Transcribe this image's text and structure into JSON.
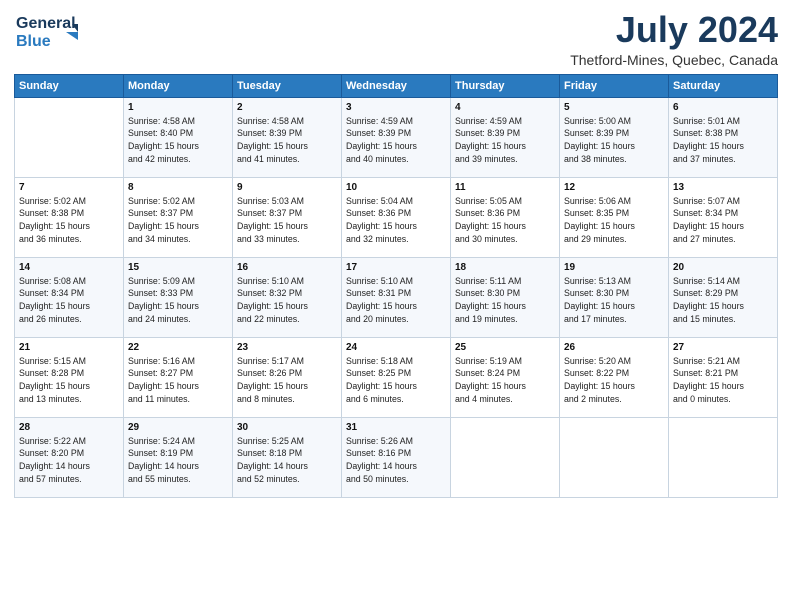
{
  "header": {
    "logo_line1": "General",
    "logo_line2": "Blue",
    "month_year": "July 2024",
    "location": "Thetford-Mines, Quebec, Canada"
  },
  "weekdays": [
    "Sunday",
    "Monday",
    "Tuesday",
    "Wednesday",
    "Thursday",
    "Friday",
    "Saturday"
  ],
  "weeks": [
    [
      {
        "day": "",
        "info": ""
      },
      {
        "day": "1",
        "info": "Sunrise: 4:58 AM\nSunset: 8:40 PM\nDaylight: 15 hours\nand 42 minutes."
      },
      {
        "day": "2",
        "info": "Sunrise: 4:58 AM\nSunset: 8:39 PM\nDaylight: 15 hours\nand 41 minutes."
      },
      {
        "day": "3",
        "info": "Sunrise: 4:59 AM\nSunset: 8:39 PM\nDaylight: 15 hours\nand 40 minutes."
      },
      {
        "day": "4",
        "info": "Sunrise: 4:59 AM\nSunset: 8:39 PM\nDaylight: 15 hours\nand 39 minutes."
      },
      {
        "day": "5",
        "info": "Sunrise: 5:00 AM\nSunset: 8:39 PM\nDaylight: 15 hours\nand 38 minutes."
      },
      {
        "day": "6",
        "info": "Sunrise: 5:01 AM\nSunset: 8:38 PM\nDaylight: 15 hours\nand 37 minutes."
      }
    ],
    [
      {
        "day": "7",
        "info": "Sunrise: 5:02 AM\nSunset: 8:38 PM\nDaylight: 15 hours\nand 36 minutes."
      },
      {
        "day": "8",
        "info": "Sunrise: 5:02 AM\nSunset: 8:37 PM\nDaylight: 15 hours\nand 34 minutes."
      },
      {
        "day": "9",
        "info": "Sunrise: 5:03 AM\nSunset: 8:37 PM\nDaylight: 15 hours\nand 33 minutes."
      },
      {
        "day": "10",
        "info": "Sunrise: 5:04 AM\nSunset: 8:36 PM\nDaylight: 15 hours\nand 32 minutes."
      },
      {
        "day": "11",
        "info": "Sunrise: 5:05 AM\nSunset: 8:36 PM\nDaylight: 15 hours\nand 30 minutes."
      },
      {
        "day": "12",
        "info": "Sunrise: 5:06 AM\nSunset: 8:35 PM\nDaylight: 15 hours\nand 29 minutes."
      },
      {
        "day": "13",
        "info": "Sunrise: 5:07 AM\nSunset: 8:34 PM\nDaylight: 15 hours\nand 27 minutes."
      }
    ],
    [
      {
        "day": "14",
        "info": "Sunrise: 5:08 AM\nSunset: 8:34 PM\nDaylight: 15 hours\nand 26 minutes."
      },
      {
        "day": "15",
        "info": "Sunrise: 5:09 AM\nSunset: 8:33 PM\nDaylight: 15 hours\nand 24 minutes."
      },
      {
        "day": "16",
        "info": "Sunrise: 5:10 AM\nSunset: 8:32 PM\nDaylight: 15 hours\nand 22 minutes."
      },
      {
        "day": "17",
        "info": "Sunrise: 5:10 AM\nSunset: 8:31 PM\nDaylight: 15 hours\nand 20 minutes."
      },
      {
        "day": "18",
        "info": "Sunrise: 5:11 AM\nSunset: 8:30 PM\nDaylight: 15 hours\nand 19 minutes."
      },
      {
        "day": "19",
        "info": "Sunrise: 5:13 AM\nSunset: 8:30 PM\nDaylight: 15 hours\nand 17 minutes."
      },
      {
        "day": "20",
        "info": "Sunrise: 5:14 AM\nSunset: 8:29 PM\nDaylight: 15 hours\nand 15 minutes."
      }
    ],
    [
      {
        "day": "21",
        "info": "Sunrise: 5:15 AM\nSunset: 8:28 PM\nDaylight: 15 hours\nand 13 minutes."
      },
      {
        "day": "22",
        "info": "Sunrise: 5:16 AM\nSunset: 8:27 PM\nDaylight: 15 hours\nand 11 minutes."
      },
      {
        "day": "23",
        "info": "Sunrise: 5:17 AM\nSunset: 8:26 PM\nDaylight: 15 hours\nand 8 minutes."
      },
      {
        "day": "24",
        "info": "Sunrise: 5:18 AM\nSunset: 8:25 PM\nDaylight: 15 hours\nand 6 minutes."
      },
      {
        "day": "25",
        "info": "Sunrise: 5:19 AM\nSunset: 8:24 PM\nDaylight: 15 hours\nand 4 minutes."
      },
      {
        "day": "26",
        "info": "Sunrise: 5:20 AM\nSunset: 8:22 PM\nDaylight: 15 hours\nand 2 minutes."
      },
      {
        "day": "27",
        "info": "Sunrise: 5:21 AM\nSunset: 8:21 PM\nDaylight: 15 hours\nand 0 minutes."
      }
    ],
    [
      {
        "day": "28",
        "info": "Sunrise: 5:22 AM\nSunset: 8:20 PM\nDaylight: 14 hours\nand 57 minutes."
      },
      {
        "day": "29",
        "info": "Sunrise: 5:24 AM\nSunset: 8:19 PM\nDaylight: 14 hours\nand 55 minutes."
      },
      {
        "day": "30",
        "info": "Sunrise: 5:25 AM\nSunset: 8:18 PM\nDaylight: 14 hours\nand 52 minutes."
      },
      {
        "day": "31",
        "info": "Sunrise: 5:26 AM\nSunset: 8:16 PM\nDaylight: 14 hours\nand 50 minutes."
      },
      {
        "day": "",
        "info": ""
      },
      {
        "day": "",
        "info": ""
      },
      {
        "day": "",
        "info": ""
      }
    ]
  ]
}
